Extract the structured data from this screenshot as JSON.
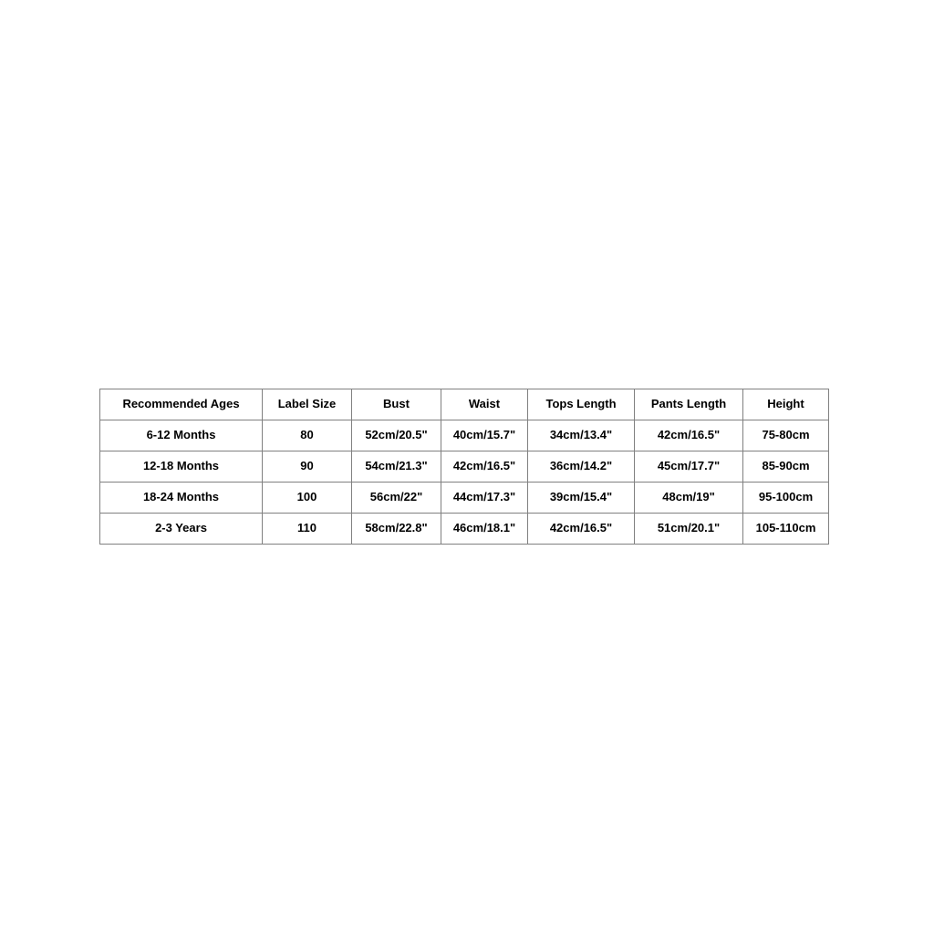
{
  "page": {
    "background_color": "#ffffff",
    "border_color": "#808080",
    "text_color": "#000000"
  },
  "size_chart": {
    "columns": [
      "Recommended Ages",
      "Label Size",
      "Bust",
      "Waist",
      "Tops Length",
      "Pants Length",
      "Height"
    ],
    "rows": [
      {
        "ages": "6-12 Months",
        "label_size": "80",
        "bust": "52cm/20.5\"",
        "waist": "40cm/15.7\"",
        "tops_length": "34cm/13.4\"",
        "pants_length": "42cm/16.5\"",
        "height": "75-80cm"
      },
      {
        "ages": "12-18 Months",
        "label_size": "90",
        "bust": "54cm/21.3\"",
        "waist": "42cm/16.5\"",
        "tops_length": "36cm/14.2\"",
        "pants_length": "45cm/17.7\"",
        "height": "85-90cm"
      },
      {
        "ages": "18-24 Months",
        "label_size": "100",
        "bust": "56cm/22\"",
        "waist": "44cm/17.3\"",
        "tops_length": "39cm/15.4\"",
        "pants_length": "48cm/19\"",
        "height": "95-100cm"
      },
      {
        "ages": "2-3 Years",
        "label_size": "110",
        "bust": "58cm/22.8\"",
        "waist": "46cm/18.1\"",
        "tops_length": "42cm/16.5\"",
        "pants_length": "51cm/20.1\"",
        "height": "105-110cm"
      }
    ]
  }
}
